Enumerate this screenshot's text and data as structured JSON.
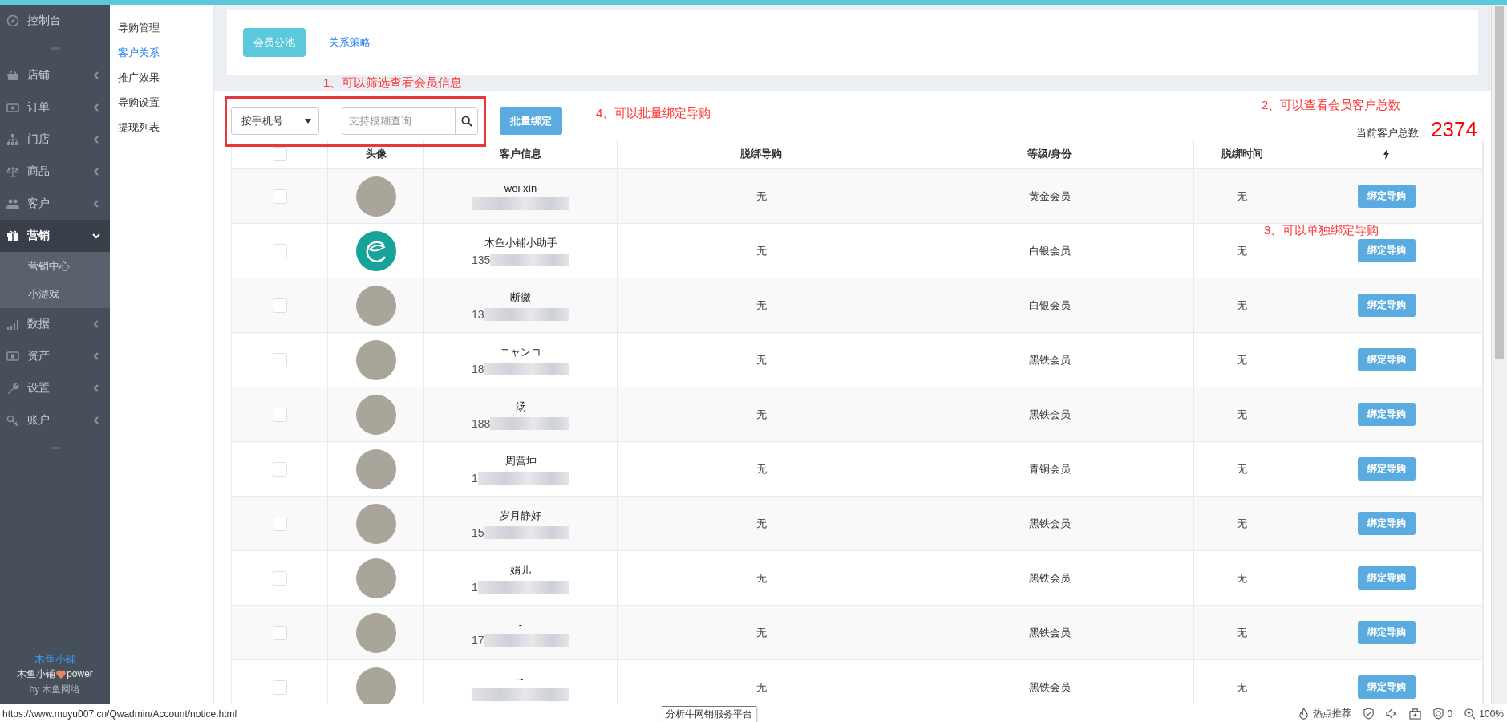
{
  "sidebar": {
    "items": [
      {
        "kind": "link",
        "label": "控制台",
        "selected": false
      },
      {
        "kind": "separator"
      },
      {
        "kind": "group",
        "label": "店铺",
        "selected": false,
        "expanded": false
      },
      {
        "kind": "group",
        "label": "订单",
        "selected": false,
        "expanded": false
      },
      {
        "kind": "group",
        "label": "门店",
        "selected": false,
        "expanded": false
      },
      {
        "kind": "group",
        "label": "商品",
        "selected": false,
        "expanded": false
      },
      {
        "kind": "group",
        "label": "客户",
        "selected": false,
        "expanded": false
      },
      {
        "kind": "group",
        "label": "营销",
        "selected": true,
        "expanded": true,
        "children": [
          {
            "label": "营销中心",
            "selected": false
          },
          {
            "label": "小游戏",
            "selected": false
          }
        ]
      },
      {
        "kind": "group",
        "label": "数据",
        "selected": false,
        "expanded": false
      },
      {
        "kind": "group",
        "label": "资产",
        "selected": false,
        "expanded": false
      },
      {
        "kind": "group",
        "label": "设置",
        "selected": false,
        "expanded": false
      },
      {
        "kind": "group",
        "label": "账户",
        "selected": false,
        "expanded": false
      },
      {
        "kind": "separator"
      }
    ],
    "footer": {
      "brand": "木鱼小铺",
      "power_prefix": "木鱼小铺",
      "power_suffix": "power",
      "by": "by 木鱼网络"
    }
  },
  "subnav": [
    {
      "label": "导购管理",
      "selected": false
    },
    {
      "label": "客户关系",
      "selected": true
    },
    {
      "label": "推广效果",
      "selected": false
    },
    {
      "label": "导购设置",
      "selected": false
    },
    {
      "label": "提现列表",
      "selected": false
    }
  ],
  "tabs": [
    {
      "label": "会员公池",
      "selected": true
    },
    {
      "label": "关系策略",
      "selected": false
    }
  ],
  "filter": {
    "select": "按手机号",
    "search_placeholder": "支持模糊查询",
    "batch_button": "批量绑定"
  },
  "total": {
    "label": "当前客户总数：",
    "value": "2374"
  },
  "table": {
    "columns": [
      {
        "kind": "checkbox",
        "checked": false
      },
      {
        "kind": "text",
        "label": "头像"
      },
      {
        "kind": "text",
        "label": "客户信息"
      },
      {
        "kind": "text",
        "label": "脱绑导购"
      },
      {
        "kind": "text",
        "label": "等级/身份"
      },
      {
        "kind": "text",
        "label": "脱绑时间"
      },
      {
        "kind": "icon"
      }
    ],
    "rows": [
      {
        "checked": false,
        "kind": "photo",
        "name": "wēi xìn",
        "unbind_guide": "无",
        "level": "黄金会员",
        "unbind_time": "无",
        "action": "绑定导购"
      },
      {
        "checked": false,
        "kind": "logo",
        "name": "木鱼小铺小助手",
        "phone": "135",
        "unbind_guide": "无",
        "level": "白银会员",
        "unbind_time": "无",
        "action": "绑定导购"
      },
      {
        "checked": false,
        "kind": "photo",
        "name": "断徽",
        "phone": "13",
        "unbind_guide": "无",
        "level": "白银会员",
        "unbind_time": "无",
        "action": "绑定导购"
      },
      {
        "checked": false,
        "kind": "photo",
        "name": "ニャンコ",
        "phone": "18",
        "unbind_guide": "无",
        "level": "黑铁会员",
        "unbind_time": "无",
        "action": "绑定导购"
      },
      {
        "checked": false,
        "kind": "photo",
        "name": "汤",
        "phone": "188",
        "unbind_guide": "无",
        "level": "黑铁会员",
        "unbind_time": "无",
        "action": "绑定导购"
      },
      {
        "checked": false,
        "kind": "photo",
        "name": "周营坤",
        "phone": "1",
        "unbind_guide": "无",
        "level": "青铜会员",
        "unbind_time": "无",
        "action": "绑定导购"
      },
      {
        "checked": false,
        "kind": "photo",
        "name": "岁月静好",
        "phone": "15",
        "unbind_guide": "无",
        "level": "黑铁会员",
        "unbind_time": "无",
        "action": "绑定导购"
      },
      {
        "checked": false,
        "kind": "photo",
        "name": "娟儿",
        "phone": "1",
        "unbind_guide": "无",
        "level": "黑铁会员",
        "unbind_time": "无",
        "action": "绑定导购"
      },
      {
        "checked": false,
        "kind": "photo",
        "name": "-",
        "phone": "17",
        "unbind_guide": "无",
        "level": "黑铁会员",
        "unbind_time": "无",
        "action": "绑定导购"
      },
      {
        "checked": false,
        "kind": "photo",
        "name": "~",
        "unbind_guide": "无",
        "level": "黑铁会员",
        "unbind_time": "无",
        "action": "绑定导购"
      }
    ]
  },
  "annotations": [
    {
      "text": "1、可以筛选查看会员信息"
    },
    {
      "text": "4、可以批量绑定导购"
    },
    {
      "text": "2、可以查看会员客户总数"
    },
    {
      "text": "3、可以单独绑定导购"
    }
  ],
  "status_bar": {
    "url": "https://www.muyu007.cn/Qwadmin/Account/notice.html",
    "tooltip": "分析牛网销服务平台",
    "hot_label": "热点推荐",
    "ad_count": "0",
    "zoom": "100%"
  }
}
